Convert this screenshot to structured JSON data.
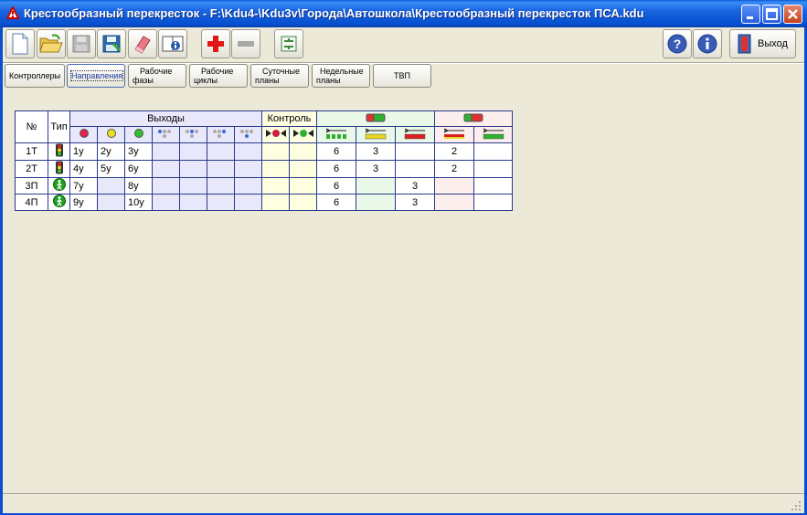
{
  "window": {
    "title": "Крестообразный перекресток - F:\\Kdu4-\\Kdu3v\\Города\\Автошкола\\Крестообразный перекресток ПСА.kdu"
  },
  "toolbar": {
    "buttons": [
      "new-file-icon",
      "open-folder-icon",
      "save-disk-icon",
      "save-as-disk-icon",
      "erase-icon",
      "properties-icon",
      "add-icon",
      "remove-icon",
      "settings-icon",
      "help-icon",
      "info-icon"
    ],
    "exit_label": "Выход"
  },
  "nav": {
    "controllers": "Контроллеры",
    "directions": "Направления",
    "work_phases": [
      "Рабочие",
      "фазы"
    ],
    "work_cycles": [
      "Рабочие",
      "циклы"
    ],
    "daily_plans": [
      "Суточные",
      "планы"
    ],
    "weekly_plans": [
      "Недельные",
      "планы"
    ],
    "tvp": "ТВП"
  },
  "grid": {
    "header": {
      "no": "№",
      "type": "Тип",
      "outputs": "Выходы",
      "control": "Контроль"
    },
    "rows": [
      {
        "no": "1Т",
        "type": "vehicle-traffic-light-icon",
        "out": [
          "1у",
          "2у",
          "3у"
        ],
        "g": [
          "6",
          "3",
          ""
        ],
        "r": [
          "2",
          ""
        ]
      },
      {
        "no": "2Т",
        "type": "vehicle-traffic-light-icon",
        "out": [
          "4у",
          "5у",
          "6у"
        ],
        "g": [
          "6",
          "3",
          ""
        ],
        "r": [
          "2",
          ""
        ]
      },
      {
        "no": "3П",
        "type": "pedestrian-light-icon",
        "out": [
          "7у",
          "",
          "8у"
        ],
        "g": [
          "6",
          "",
          "3"
        ],
        "r": [
          "",
          ""
        ]
      },
      {
        "no": "4П",
        "type": "pedestrian-light-icon",
        "out": [
          "9у",
          "",
          "10у"
        ],
        "g": [
          "6",
          "",
          "3"
        ],
        "r": [
          "",
          ""
        ]
      }
    ]
  },
  "colors": {
    "titlebar": "#0a5fd8",
    "outputs_bg": "#e8e8fa",
    "control_bg": "#fefee0",
    "green_group_bg": "#eaf8ea",
    "red_group_bg": "#fdeeee",
    "grid_border": "#2a3a8a"
  }
}
